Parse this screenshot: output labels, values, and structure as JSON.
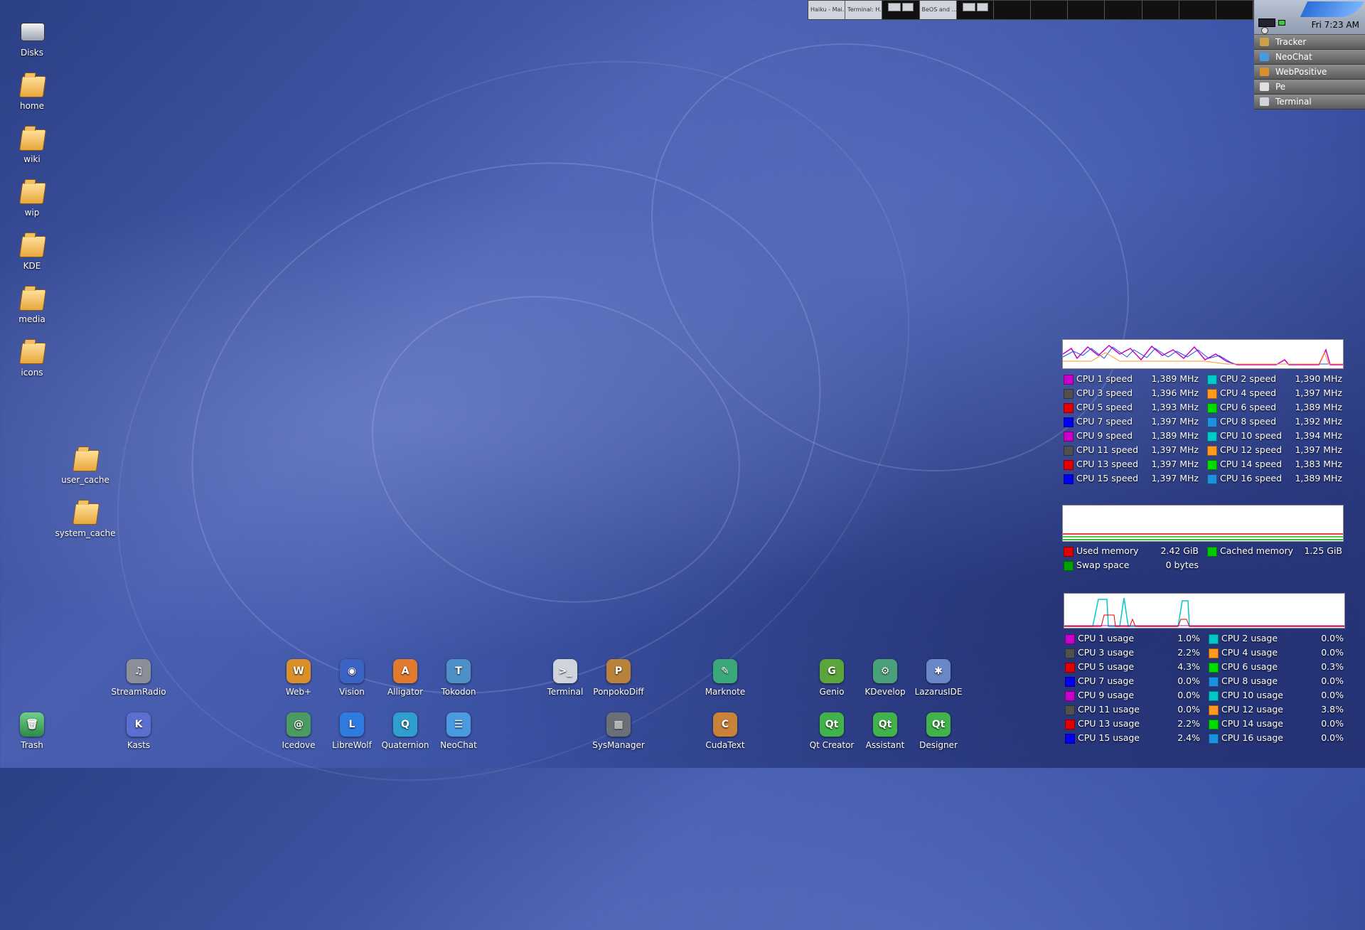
{
  "desktop_icons_left": [
    {
      "id": "disks",
      "label": "Disks",
      "kind": "disk"
    },
    {
      "id": "home",
      "label": "home",
      "kind": "folder"
    },
    {
      "id": "wiki",
      "label": "wiki",
      "kind": "folder"
    },
    {
      "id": "wip",
      "label": "wip",
      "kind": "folder"
    },
    {
      "id": "kde",
      "label": "KDE",
      "kind": "folder"
    },
    {
      "id": "media",
      "label": "media",
      "kind": "folder"
    },
    {
      "id": "icons",
      "label": "icons",
      "kind": "folder"
    }
  ],
  "desktop_icons_cache": [
    {
      "id": "user-cache",
      "label": "user_cache"
    },
    {
      "id": "system-cache",
      "label": "system_cache"
    }
  ],
  "trash": {
    "label": "Trash"
  },
  "app_icons_row1": [
    {
      "id": "streamradio",
      "label": "StreamRadio",
      "color": "#8a8f99",
      "glyph": "♫"
    },
    {
      "id": "web-plus",
      "label": "Web+",
      "color": "#d9902a",
      "glyph": "W"
    },
    {
      "id": "vision",
      "label": "Vision",
      "color": "#3b63c4",
      "glyph": "◉"
    },
    {
      "id": "alligator",
      "label": "Alligator",
      "color": "#e07a2f",
      "glyph": "A"
    },
    {
      "id": "tokodon",
      "label": "Tokodon",
      "color": "#4d8fc7",
      "glyph": "T"
    },
    {
      "id": "terminal",
      "label": "Terminal",
      "color": "#cfd3dc",
      "glyph": ">_"
    },
    {
      "id": "ponpokodiff",
      "label": "PonpokoDiff",
      "color": "#b9823a",
      "glyph": "P"
    },
    {
      "id": "marknote",
      "label": "Marknote",
      "color": "#3aa878",
      "glyph": "✎"
    },
    {
      "id": "genio",
      "label": "Genio",
      "color": "#5aa63a",
      "glyph": "G"
    },
    {
      "id": "kdevelop",
      "label": "KDevelop",
      "color": "#4aa07a",
      "glyph": "⚙"
    },
    {
      "id": "lazaruside",
      "label": "LazarusIDE",
      "color": "#6a88c8",
      "glyph": "✱"
    }
  ],
  "app_icons_row2": [
    {
      "id": "kasts",
      "label": "Kasts",
      "color": "#5b6fd0",
      "glyph": "K"
    },
    {
      "id": "icedove",
      "label": "Icedove",
      "color": "#4b9a62",
      "glyph": "@"
    },
    {
      "id": "librewolf",
      "label": "LibreWolf",
      "color": "#2f7be0",
      "glyph": "L"
    },
    {
      "id": "quaternion",
      "label": "Quaternion",
      "color": "#2f9fd0",
      "glyph": "Q"
    },
    {
      "id": "neochat",
      "label": "NeoChat",
      "color": "#4a9ae0",
      "glyph": "☰"
    },
    {
      "id": "sysmanager",
      "label": "SysManager",
      "color": "#6a6f78",
      "glyph": "▦"
    },
    {
      "id": "cudatext",
      "label": "CudaText",
      "color": "#c8823a",
      "glyph": "C"
    },
    {
      "id": "qt-creator",
      "label": "Qt Creator",
      "color": "#41b34a",
      "glyph": "Qt"
    },
    {
      "id": "assistant",
      "label": "Assistant",
      "color": "#41b34a",
      "glyph": "Qt"
    },
    {
      "id": "designer",
      "label": "Designer",
      "color": "#41b34a",
      "glyph": "Qt"
    }
  ],
  "workspaces": [
    {
      "caption": "Haiku - Mai...",
      "light": true
    },
    {
      "caption": "Terminal: H...",
      "light": true
    },
    {
      "caption": "",
      "light": false
    },
    {
      "caption": "BeOS and ...",
      "light": true
    },
    {
      "caption": "",
      "light": false
    },
    {
      "caption": "",
      "light": false
    },
    {
      "caption": "",
      "light": false
    },
    {
      "caption": "",
      "light": false
    },
    {
      "caption": "",
      "light": false
    },
    {
      "caption": "",
      "light": false
    },
    {
      "caption": "",
      "light": false
    },
    {
      "caption": "",
      "light": false
    }
  ],
  "deskbar": {
    "clock": "Fri 7:23 AM",
    "items": [
      {
        "label": "Tracker",
        "color": "#c9a14a"
      },
      {
        "label": "NeoChat",
        "color": "#4a9ae0"
      },
      {
        "label": "WebPositive",
        "color": "#d9902a"
      },
      {
        "label": "Pe",
        "color": "#e0e0e0"
      },
      {
        "label": "Terminal",
        "color": "#cfd3dc"
      }
    ]
  },
  "cpu_speed": {
    "rows": [
      [
        {
          "name": "CPU 1 speed",
          "value": "1,389 MHz",
          "color": "#c800c8"
        },
        {
          "name": "CPU 2 speed",
          "value": "1,390 MHz",
          "color": "#00c8c8"
        }
      ],
      [
        {
          "name": "CPU 3 speed",
          "value": "1,396 MHz",
          "color": "#505050"
        },
        {
          "name": "CPU 4 speed",
          "value": "1,397 MHz",
          "color": "#ff9a1e"
        }
      ],
      [
        {
          "name": "CPU 5 speed",
          "value": "1,393 MHz",
          "color": "#e00000"
        },
        {
          "name": "CPU 6 speed",
          "value": "1,389 MHz",
          "color": "#00dc00"
        }
      ],
      [
        {
          "name": "CPU 7 speed",
          "value": "1,397 MHz",
          "color": "#0000f0"
        },
        {
          "name": "CPU 8 speed",
          "value": "1,392 MHz",
          "color": "#1e90e0"
        }
      ],
      [
        {
          "name": "CPU 9 speed",
          "value": "1,389 MHz",
          "color": "#c800c8"
        },
        {
          "name": "CPU 10 speed",
          "value": "1,394 MHz",
          "color": "#00c8c8"
        }
      ],
      [
        {
          "name": "CPU 11 speed",
          "value": "1,397 MHz",
          "color": "#505050"
        },
        {
          "name": "CPU 12 speed",
          "value": "1,397 MHz",
          "color": "#ff9a1e"
        }
      ],
      [
        {
          "name": "CPU 13 speed",
          "value": "1,397 MHz",
          "color": "#e00000"
        },
        {
          "name": "CPU 14 speed",
          "value": "1,383 MHz",
          "color": "#00dc00"
        }
      ],
      [
        {
          "name": "CPU 15 speed",
          "value": "1,397 MHz",
          "color": "#0000f0"
        },
        {
          "name": "CPU 16 speed",
          "value": "1,389 MHz",
          "color": "#1e90e0"
        }
      ]
    ]
  },
  "memory": {
    "rows": [
      [
        {
          "name": "Used memory",
          "value": "2.42 GiB",
          "color": "#e00000"
        },
        {
          "name": "Cached memory",
          "value": "1.25 GiB",
          "color": "#00c800"
        }
      ],
      [
        {
          "name": "Swap space",
          "value": "0 bytes",
          "color": "#00a000"
        }
      ]
    ]
  },
  "cpu_usage": {
    "rows": [
      [
        {
          "name": "CPU 1 usage",
          "value": "1.0%",
          "color": "#c800c8"
        },
        {
          "name": "CPU 2 usage",
          "value": "0.0%",
          "color": "#00c8c8"
        }
      ],
      [
        {
          "name": "CPU 3 usage",
          "value": "2.2%",
          "color": "#505050"
        },
        {
          "name": "CPU 4 usage",
          "value": "0.0%",
          "color": "#ff9a1e"
        }
      ],
      [
        {
          "name": "CPU 5 usage",
          "value": "4.3%",
          "color": "#e00000"
        },
        {
          "name": "CPU 6 usage",
          "value": "0.3%",
          "color": "#00dc00"
        }
      ],
      [
        {
          "name": "CPU 7 usage",
          "value": "0.0%",
          "color": "#0000f0"
        },
        {
          "name": "CPU 8 usage",
          "value": "0.0%",
          "color": "#1e90e0"
        }
      ],
      [
        {
          "name": "CPU 9 usage",
          "value": "0.0%",
          "color": "#c800c8"
        },
        {
          "name": "CPU 10 usage",
          "value": "0.0%",
          "color": "#00c8c8"
        }
      ],
      [
        {
          "name": "CPU 11 usage",
          "value": "0.0%",
          "color": "#505050"
        },
        {
          "name": "CPU 12 usage",
          "value": "3.8%",
          "color": "#ff9a1e"
        }
      ],
      [
        {
          "name": "CPU 13 usage",
          "value": "2.2%",
          "color": "#e00000"
        },
        {
          "name": "CPU 14 usage",
          "value": "0.0%",
          "color": "#00dc00"
        }
      ],
      [
        {
          "name": "CPU 15 usage",
          "value": "2.4%",
          "color": "#0000f0"
        },
        {
          "name": "CPU 16 usage",
          "value": "0.0%",
          "color": "#1e90e0"
        }
      ]
    ]
  }
}
